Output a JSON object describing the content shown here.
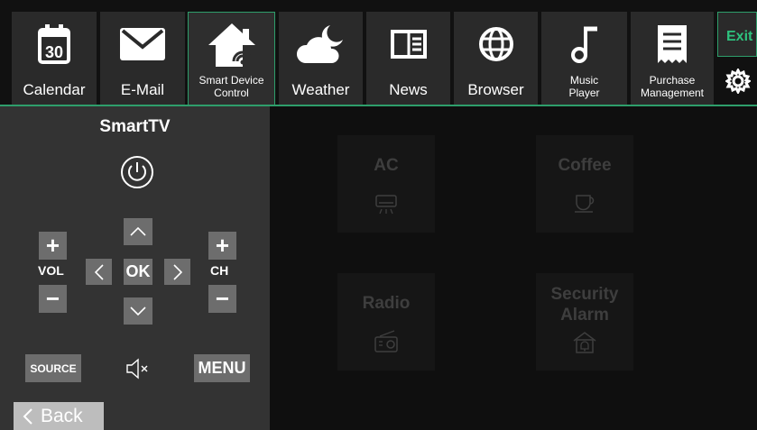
{
  "topbar": {
    "tiles": [
      {
        "label": "Calendar",
        "icon": "calendar-icon",
        "icon_text": "30"
      },
      {
        "label": "E-Mail",
        "icon": "mail-icon"
      },
      {
        "label": "Smart Device Control",
        "label_line1": "Smart Device",
        "label_line2": "Control",
        "icon": "smart-home-icon",
        "active": true
      },
      {
        "label": "Weather",
        "icon": "weather-icon"
      },
      {
        "label": "News",
        "icon": "news-icon"
      },
      {
        "label": "Browser",
        "icon": "globe-icon"
      },
      {
        "label_line1": "Music",
        "label_line2": "Player",
        "icon": "music-note-icon"
      },
      {
        "label_line1": "Purchase",
        "label_line2": "Management",
        "icon": "receipt-icon"
      }
    ],
    "exit_label": "Exit",
    "settings_icon": "gear-icon"
  },
  "remote": {
    "title": "SmartTV",
    "vol_label": "VOL",
    "ch_label": "CH",
    "plus": "+",
    "minus": "−",
    "ok_label": "OK",
    "source_label": "SOURCE",
    "menu_label": "MENU",
    "mute_icon": "mute-icon",
    "power_icon": "power-icon"
  },
  "back_label": "Back",
  "devices": [
    {
      "name": "AC",
      "icon": "air-conditioner-icon"
    },
    {
      "name": "Coffee",
      "icon": "coffee-cup-icon"
    },
    {
      "name": "Radio",
      "icon": "radio-icon"
    },
    {
      "name_line1": "Security",
      "name_line2": "Alarm",
      "icon": "alarm-bell-icon"
    }
  ],
  "colors": {
    "accent": "#2e9e6b",
    "exit_text": "#2ec27e",
    "button_gray": "#6d6d6d",
    "panel": "#333333",
    "device_text": "#3e3e3e"
  }
}
